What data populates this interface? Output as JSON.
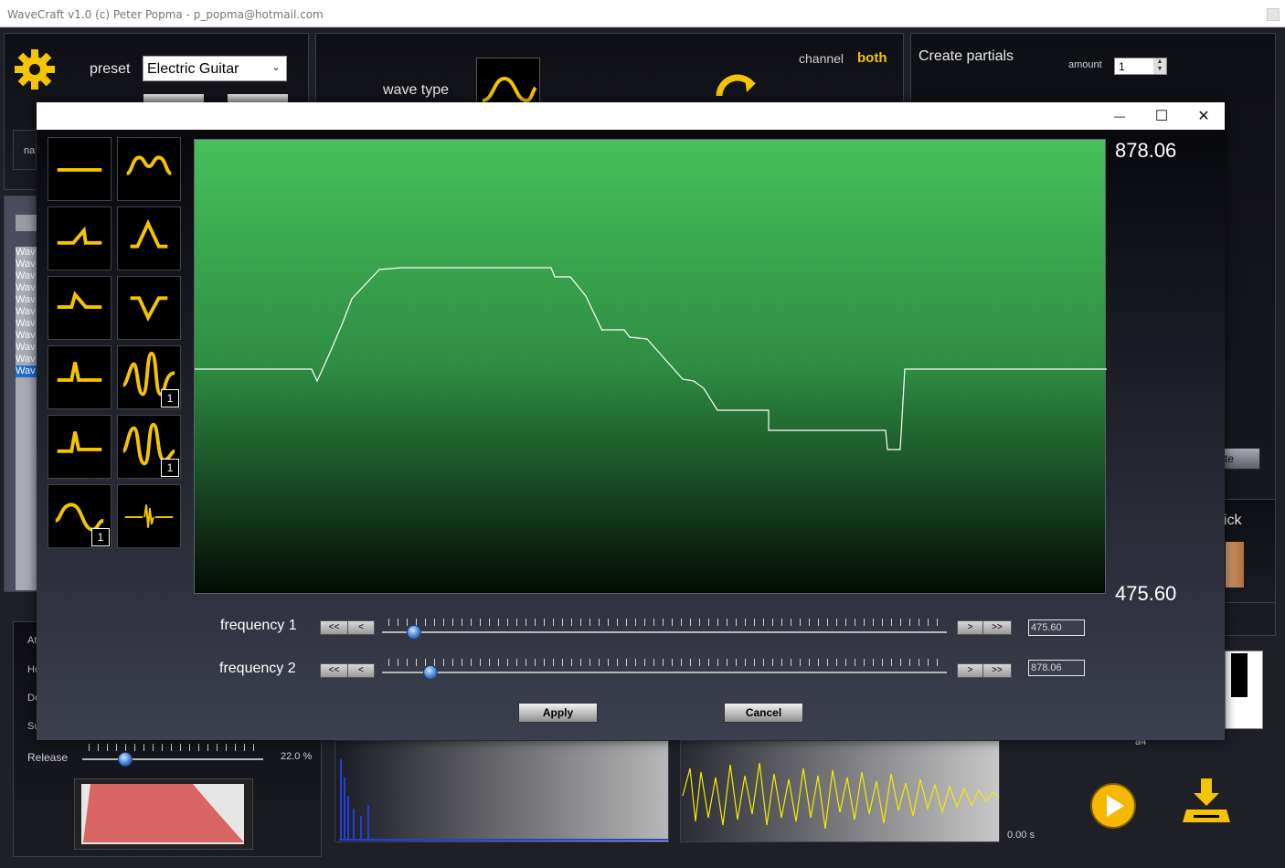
{
  "app": {
    "title": "WaveCraft v1.0   (c) Peter Popma - p_popma@hotmail.com"
  },
  "colors": {
    "accent": "#f5c400",
    "plot_top": "#46c05a",
    "plot_bottom": "#040c05",
    "envelope_fill": "#d86464"
  },
  "background": {
    "preset_label": "preset",
    "preset_value": "Electric Guitar",
    "wave_type_label": "wave type",
    "channel_label": "channel",
    "channel_value": "both",
    "create_partials_label": "Create partials",
    "amount_label": "amount",
    "amount_value": "1",
    "name_fragment": "na",
    "list_fragment": "Wav",
    "release_label": "Release",
    "release_value": "22.0 %",
    "adsr_fragments": [
      "At",
      "Ho",
      "De",
      "Su"
    ],
    "time_value": "0.00 s",
    "key_label": "a4",
    "pick_fragment": "ick",
    "button_fragment": "te",
    "icons": [
      "gear-icon",
      "refresh-icon",
      "play-icon",
      "download-icon"
    ]
  },
  "dialog": {
    "window_controls": {
      "minimize": "—",
      "maximize": "☐",
      "close": "✕"
    },
    "tools": [
      {
        "name": "flat-line-tool",
        "badge": ""
      },
      {
        "name": "bump-wave-tool",
        "badge": ""
      },
      {
        "name": "step-up-tool",
        "badge": ""
      },
      {
        "name": "peak-tool",
        "badge": ""
      },
      {
        "name": "step-down-tool",
        "badge": ""
      },
      {
        "name": "dip-tool",
        "badge": ""
      },
      {
        "name": "pulse-tool",
        "badge": ""
      },
      {
        "name": "oscillation-tool",
        "badge": "1"
      },
      {
        "name": "decay-pulse-tool",
        "badge": ""
      },
      {
        "name": "damped-oscillation-tool",
        "badge": "1"
      },
      {
        "name": "sine-period-tool",
        "badge": "1"
      },
      {
        "name": "noise-spike-tool",
        "badge": ""
      }
    ],
    "plot": {
      "max_label": "878.06",
      "min_label": "475.60"
    },
    "frequency1": {
      "label": "frequency 1",
      "value": "475.60",
      "level": 0.056
    },
    "frequency2": {
      "label": "frequency 2",
      "value": "878.06",
      "level": 0.086
    },
    "nav_buttons": {
      "first": "<<",
      "prev": "<",
      "next": ">",
      "last": ">>"
    },
    "apply_label": "Apply",
    "cancel_label": "Cancel"
  }
}
